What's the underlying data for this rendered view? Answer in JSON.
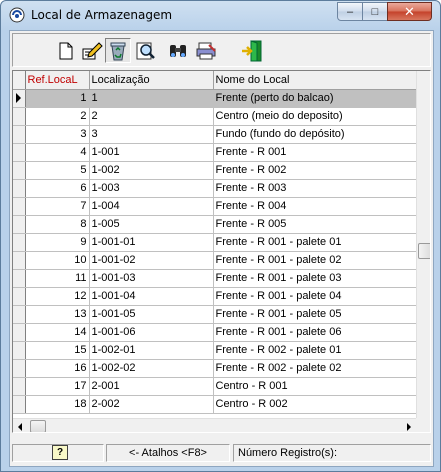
{
  "window": {
    "title": "Local de Armazenagem",
    "controls": {
      "minimize": "–",
      "maximize": "□",
      "close": "✕"
    }
  },
  "toolbar": {
    "buttons": [
      {
        "name": "new-record",
        "icon": "new-document-icon"
      },
      {
        "name": "edit-record",
        "icon": "edit-pencil-icon"
      },
      {
        "name": "delete-record",
        "icon": "recycle-bin-icon",
        "pressed": true
      },
      {
        "name": "search-record",
        "icon": "magnifier-icon"
      },
      {
        "name": "find-record",
        "icon": "binoculars-icon"
      },
      {
        "name": "print-record",
        "icon": "print-icon"
      },
      {
        "name": "exit",
        "icon": "exit-door-icon"
      }
    ]
  },
  "grid": {
    "columns": [
      "Ref.LocaL",
      "Localização",
      "Nome do Local"
    ],
    "selected_row": 0,
    "rows": [
      {
        "ref": "1",
        "loc": "1",
        "nome": "Frente (perto do balcao)"
      },
      {
        "ref": "2",
        "loc": "2",
        "nome": "Centro (meio do deposito)"
      },
      {
        "ref": "3",
        "loc": "3",
        "nome": "Fundo (fundo do depósito)"
      },
      {
        "ref": "4",
        "loc": "1-001",
        "nome": "Frente - R 001"
      },
      {
        "ref": "5",
        "loc": "1-002",
        "nome": "Frente - R 002"
      },
      {
        "ref": "6",
        "loc": "1-003",
        "nome": "Frente - R 003"
      },
      {
        "ref": "7",
        "loc": "1-004",
        "nome": "Frente - R 004"
      },
      {
        "ref": "8",
        "loc": "1-005",
        "nome": "Frente - R 005"
      },
      {
        "ref": "9",
        "loc": "1-001-01",
        "nome": "Frente - R 001 - palete 01"
      },
      {
        "ref": "10",
        "loc": "1-001-02",
        "nome": "Frente - R 001 - palete 02"
      },
      {
        "ref": "11",
        "loc": "1-001-03",
        "nome": "Frente - R 001 - palete 03"
      },
      {
        "ref": "12",
        "loc": "1-001-04",
        "nome": "Frente - R 001 - palete 04"
      },
      {
        "ref": "13",
        "loc": "1-001-05",
        "nome": "Frente - R 001 - palete 05"
      },
      {
        "ref": "14",
        "loc": "1-001-06",
        "nome": "Frente - R 001 - palete 06"
      },
      {
        "ref": "15",
        "loc": "1-002-01",
        "nome": "Frente - R 002 - palete 01"
      },
      {
        "ref": "16",
        "loc": "1-002-02",
        "nome": "Frente - R 002 - palete 02"
      },
      {
        "ref": "17",
        "loc": "2-001",
        "nome": "Centro - R 001"
      },
      {
        "ref": "18",
        "loc": "2-002",
        "nome": "Centro - R 002"
      }
    ]
  },
  "status": {
    "help": "?",
    "shortcuts": "<- Atalhos <F8>",
    "record_count": "Número Registro(s):"
  },
  "colors": {
    "header_accent": "#c00000",
    "selected_row": "#c0c0c0",
    "title_bar": "#b9d1ea"
  }
}
